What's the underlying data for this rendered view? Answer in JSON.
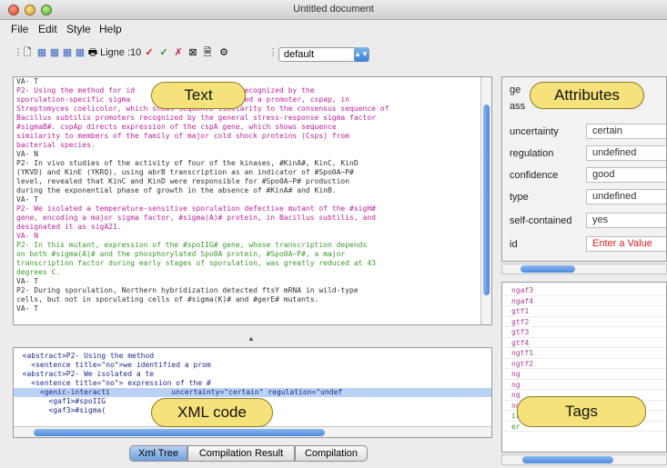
{
  "window": {
    "title": "Untitled document"
  },
  "menu": [
    "File",
    "Edit",
    "Style",
    "Help"
  ],
  "toolbar": {
    "ligne_label": "Ligne :10",
    "style_select": "default"
  },
  "text_panel": {
    "lines": [
      {
        "t": "VA- T",
        "c": "c-dark"
      },
      {
        "t": "P2- Using the method for id              promoters recognized by the",
        "c": "c-mag"
      },
      {
        "t": "sporulation-specific sigma               we identified a promoter, cspap, in",
        "c": "c-mag"
      },
      {
        "t": "Streptomyces coelicolor, which shows sequence similarity to the consensus sequence of",
        "c": "c-mag"
      },
      {
        "t": "Bacillus subtilis promoters recognized by the general stress-response sigma factor",
        "c": "c-mag"
      },
      {
        "t": "#sigmaB#. cspAp directs expression of the cspA gene, which shows sequence",
        "c": "c-mag"
      },
      {
        "t": "similarity to members of the family of major cold shock proteins (Csps) from",
        "c": "c-mag"
      },
      {
        "t": "bacterial species.",
        "c": "c-mag"
      },
      {
        "t": "VA- N",
        "c": "c-dark"
      },
      {
        "t": "P2- In vivo studies of the activity of four of the kinases, #KinA#, KinC, KinD",
        "c": "c-dark"
      },
      {
        "t": "(YKVD) and KinE (YKRQ), using abrB transcription as an indicator of #Spo0A~P#",
        "c": "c-dark"
      },
      {
        "t": "level, revealed that KinC and KinD were responsible for #Spo0A~P# production",
        "c": "c-dark"
      },
      {
        "t": "during the exponential phase of growth in the absence of #KinA# and KinB.",
        "c": "c-dark"
      },
      {
        "t": "VA- T",
        "c": "c-dark"
      },
      {
        "t": "P2- We isolated a temperature-sensitive sporulation defective mutant of the #sigH#",
        "c": "c-mag"
      },
      {
        "t": "gene, encoding a major sigma factor, #sigma(A)# protein, in Bacillus subtilis, and",
        "c": "c-mag"
      },
      {
        "t": "designated it as sigA21.",
        "c": "c-mag"
      },
      {
        "t": "VA- N",
        "c": "c-mag"
      },
      {
        "t": "P2- In this mutant, expression of the #spoIIG# gene, whose transcription depends",
        "c": "c-grn"
      },
      {
        "t": "on both #sigma(A)# and the phosphorylated Spo0A protein, #Spo0A~P#, a major",
        "c": "c-grn"
      },
      {
        "t": "transcription factor during early stages of sporulation, was greatly reduced at 43",
        "c": "c-grn"
      },
      {
        "t": "degrees C.",
        "c": "c-grn"
      },
      {
        "t": "VA- T",
        "c": "c-dark"
      },
      {
        "t": "P2- During sporulation, Northern hybridization detected ftsY mRNA in wild-type",
        "c": "c-dark"
      },
      {
        "t": "cells, but not in sporulating cells of #sigma(K)# and #gerE# mutants.",
        "c": "c-dark"
      },
      {
        "t": "VA- T",
        "c": "c-dark"
      }
    ]
  },
  "xml_panel": {
    "lines": [
      "  <abstract>P2- Using the method",
      "    <sentence title=\"no\">we identified a prom",
      "  <abstract>P2- We isolated a te",
      "    <sentence title=\"no\"> expression of the #",
      "      <genic-interacti              uncertainty=\"certain\" regulation=\"undef",
      "        <gaf1>#spoIIG",
      "        <gaf3>#sigma("
    ],
    "selected_index": 4
  },
  "bottom_tabs": [
    "Xml Tree",
    "Compilation Result",
    "Compilation"
  ],
  "attributes": {
    "partial_top": [
      "ge",
      "ass"
    ],
    "rows": [
      {
        "key": "uncertainty",
        "value": "certain"
      },
      {
        "key": "regulation",
        "value": "undefined"
      },
      {
        "key": "confidence",
        "value": "good"
      },
      {
        "key": "type",
        "value": "undefined"
      },
      {
        "key": "self-contained",
        "value": "yes"
      },
      {
        "key": "id",
        "value": "Enter a Value"
      }
    ]
  },
  "tags": [
    "ngaf3",
    "ngaf4",
    "gtf1",
    "gtf2",
    "gtf3",
    "gtf4",
    "ngtf1",
    "ngtf2",
    "ng",
    "ng",
    "ng",
    "ng",
    "ir",
    "er"
  ],
  "callouts": {
    "text": "Text",
    "attributes": "Attributes",
    "xml": "XML code",
    "tags": "Tags"
  },
  "colors": {
    "callout_fill": "#f6e27a",
    "scroll_thumb": "#4a8ae0",
    "tag_text": "#b13a9a",
    "error_text": "#e02020"
  }
}
